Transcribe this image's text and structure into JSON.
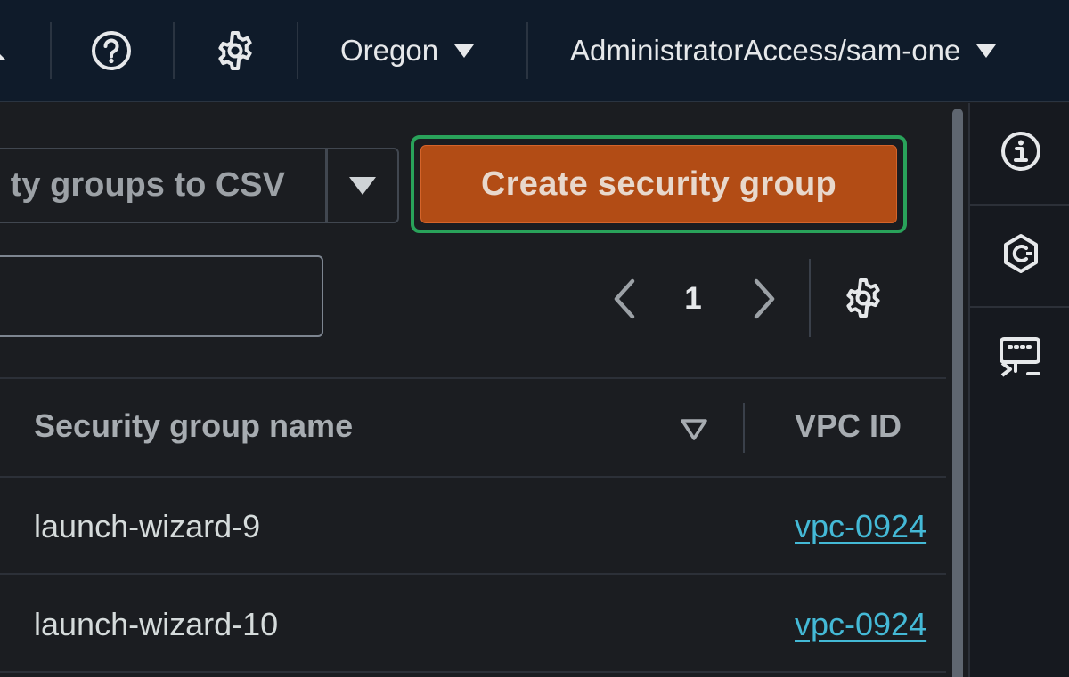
{
  "topbar": {
    "region_label": "Oregon",
    "account_label": "AdministratorAccess/sam-one",
    "icons": [
      "notification-icon",
      "help-icon",
      "gear-icon"
    ]
  },
  "toolbar": {
    "export_label": "Export security groups to CSV",
    "export_visible_text": "ty groups to CSV",
    "create_label": "Create security group"
  },
  "search": {
    "value": "",
    "placeholder": ""
  },
  "pagination": {
    "current_page": "1"
  },
  "table": {
    "columns": [
      "Security group name",
      "VPC ID"
    ],
    "rows": [
      {
        "name": "launch-wizard-9",
        "vpc_id": "vpc-0924"
      },
      {
        "name": "launch-wizard-10",
        "vpc_id": "vpc-0924"
      }
    ]
  },
  "side_panel": {
    "items": [
      "info-icon",
      "cloudshell-hex-icon",
      "terminal-icon"
    ]
  },
  "colors": {
    "topbar_bg": "#0f1b2a",
    "content_bg": "#1b1d21",
    "primary_button": "#b24c15",
    "focus_ring": "#29a25a",
    "link": "#44b9d6"
  }
}
